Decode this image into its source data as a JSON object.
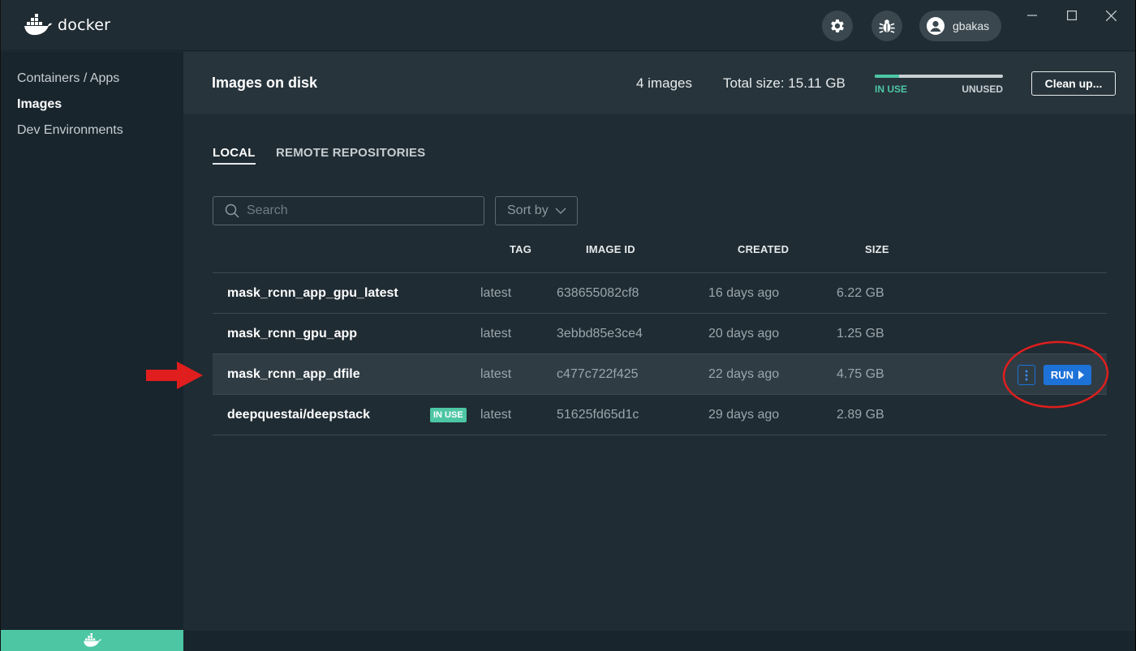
{
  "app": {
    "brand": "docker",
    "user": "gbakas"
  },
  "colors": {
    "accent": "#1d72d8",
    "in_use": "#4dc6a4",
    "background": "#202c33",
    "sidebar": "#19252d"
  },
  "sidebar": {
    "items": [
      {
        "label": "Containers / Apps",
        "active": false
      },
      {
        "label": "Images",
        "active": true
      },
      {
        "label": "Dev Environments",
        "active": false
      }
    ]
  },
  "header": {
    "title": "Images on disk",
    "image_count": "4 images",
    "total_size": "Total size: 15.11 GB",
    "usage": {
      "in_use_label": "IN USE",
      "unused_label": "UNUSED",
      "in_use_fraction": 0.19
    },
    "cleanup_label": "Clean up..."
  },
  "tabs": [
    {
      "label": "LOCAL",
      "active": true
    },
    {
      "label": "REMOTE REPOSITORIES",
      "active": false
    }
  ],
  "search": {
    "placeholder": "Search",
    "icon": "search-icon"
  },
  "sort": {
    "label": "Sort by",
    "icon": "chevron-down-icon"
  },
  "table": {
    "columns": [
      "TAG",
      "IMAGE ID",
      "CREATED",
      "SIZE"
    ],
    "rows": [
      {
        "name": "mask_rcnn_app_gpu_latest",
        "tag": "latest",
        "image_id": "638655082cf8",
        "created": "16 days ago",
        "size": "6.22 GB",
        "badge": ""
      },
      {
        "name": "mask_rcnn_gpu_app",
        "tag": "latest",
        "image_id": "3ebbd85e3ce4",
        "created": "20 days ago",
        "size": "1.25 GB",
        "badge": ""
      },
      {
        "name": "mask_rcnn_app_dfile",
        "tag": "latest",
        "image_id": "c477c722f425",
        "created": "22 days ago",
        "size": "4.75 GB",
        "badge": ""
      },
      {
        "name": "deepquestai/deepstack",
        "tag": "latest",
        "image_id": "51625fd65d1c",
        "created": "29 days ago",
        "size": "2.89 GB",
        "badge": "IN USE"
      }
    ],
    "run_label": "RUN"
  }
}
